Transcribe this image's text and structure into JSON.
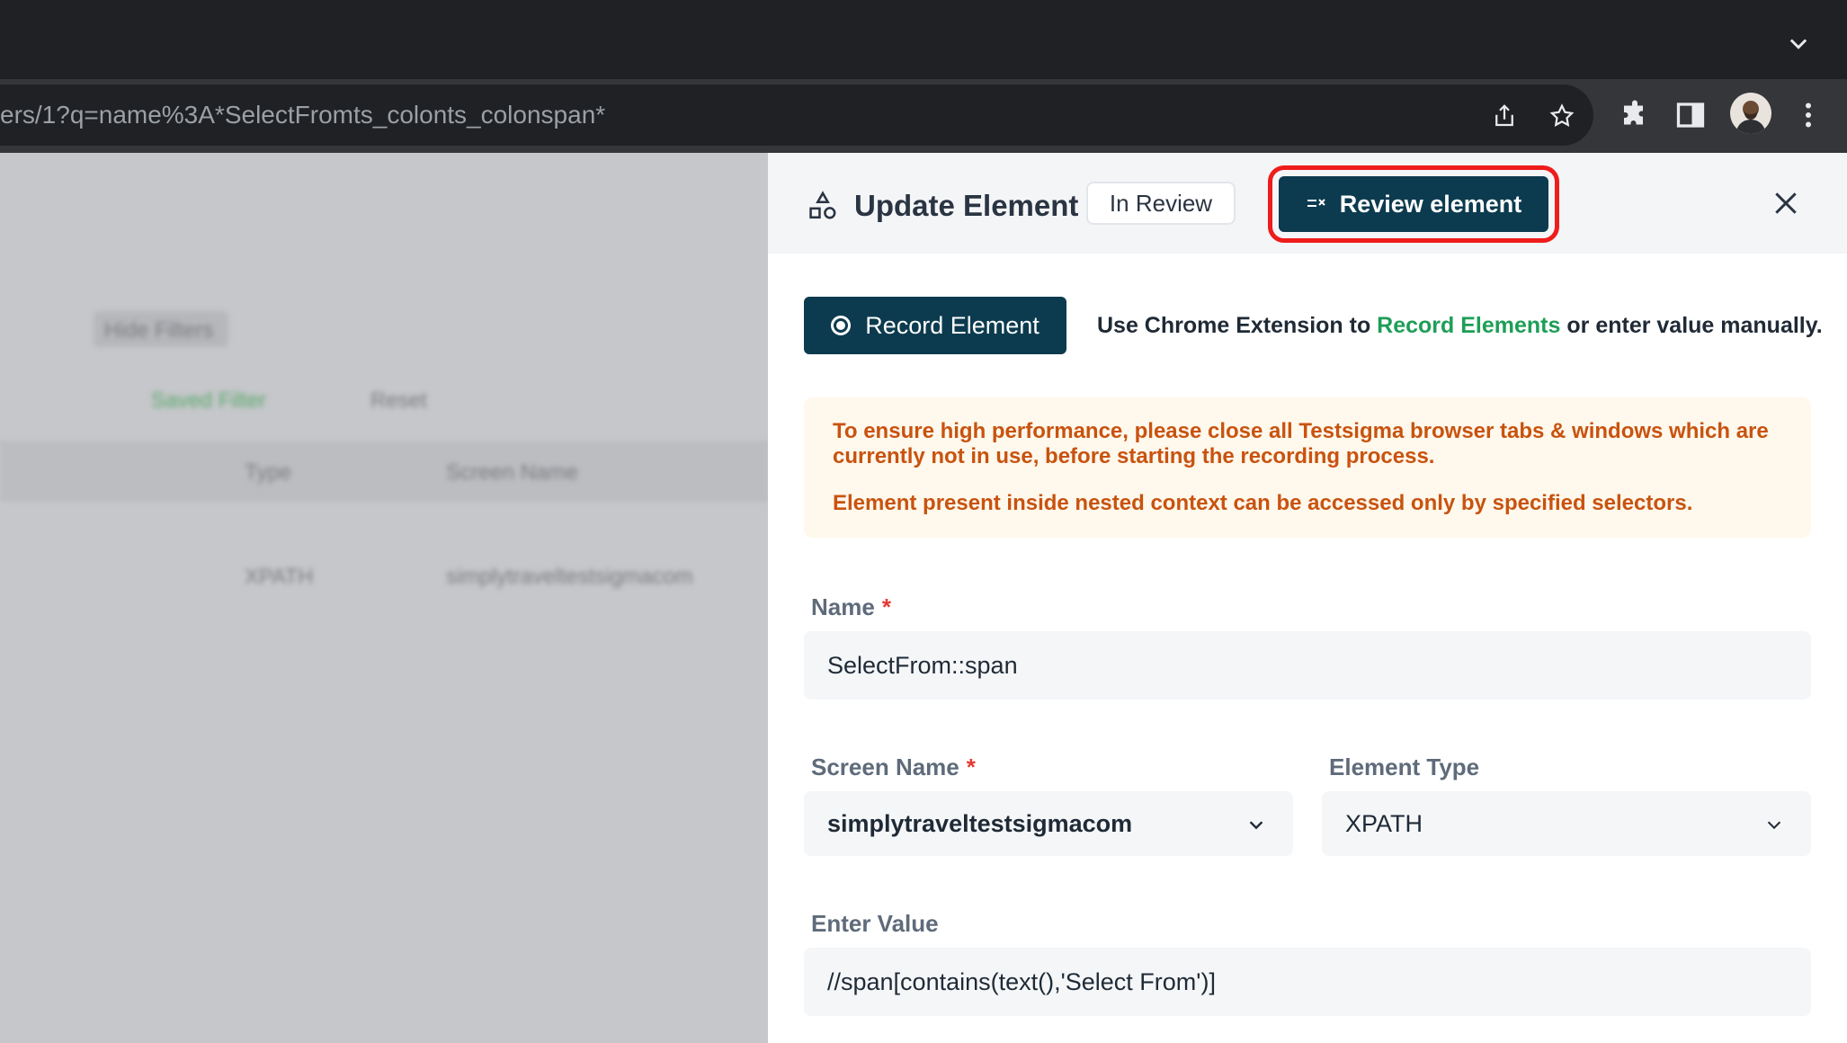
{
  "browser": {
    "url": "ers/1?q=name%3A*SelectFromts_colonts_colonspan*"
  },
  "background_page": {
    "filters": [
      "Hide Filters",
      "Saved Filter",
      "Reset"
    ],
    "columns": [
      "Type",
      "Screen Name"
    ],
    "row": [
      "XPATH",
      "simplytraveltestsigmacom"
    ]
  },
  "panel": {
    "title": "Update Element",
    "status": "In Review",
    "review_button": "Review element",
    "record_button": "Record Element",
    "hint_prefix": "Use Chrome Extension to ",
    "hint_link": "Record Elements",
    "hint_suffix": " or enter value manually.",
    "warning_1": "To ensure high performance, please close all Testsigma browser tabs & windows which are currently not in use, before starting the recording process.",
    "warning_2": "Element present inside nested context can be accessed only by specified selectors.",
    "name_label": "Name",
    "name_value": "SelectFrom::span",
    "screen_label": "Screen Name",
    "screen_value": "simplytraveltestsigmacom",
    "type_label": "Element Type",
    "type_value": "XPATH",
    "value_label": "Enter Value",
    "value_value": "//span[contains(text(),'Select From')]",
    "required_mark": "*"
  },
  "colors": {
    "primary": "#0c3b4f",
    "highlight": "#ef1c1c",
    "link": "#1e9e57",
    "warning_text": "#c8530f",
    "warning_bg": "#fff8ec"
  }
}
